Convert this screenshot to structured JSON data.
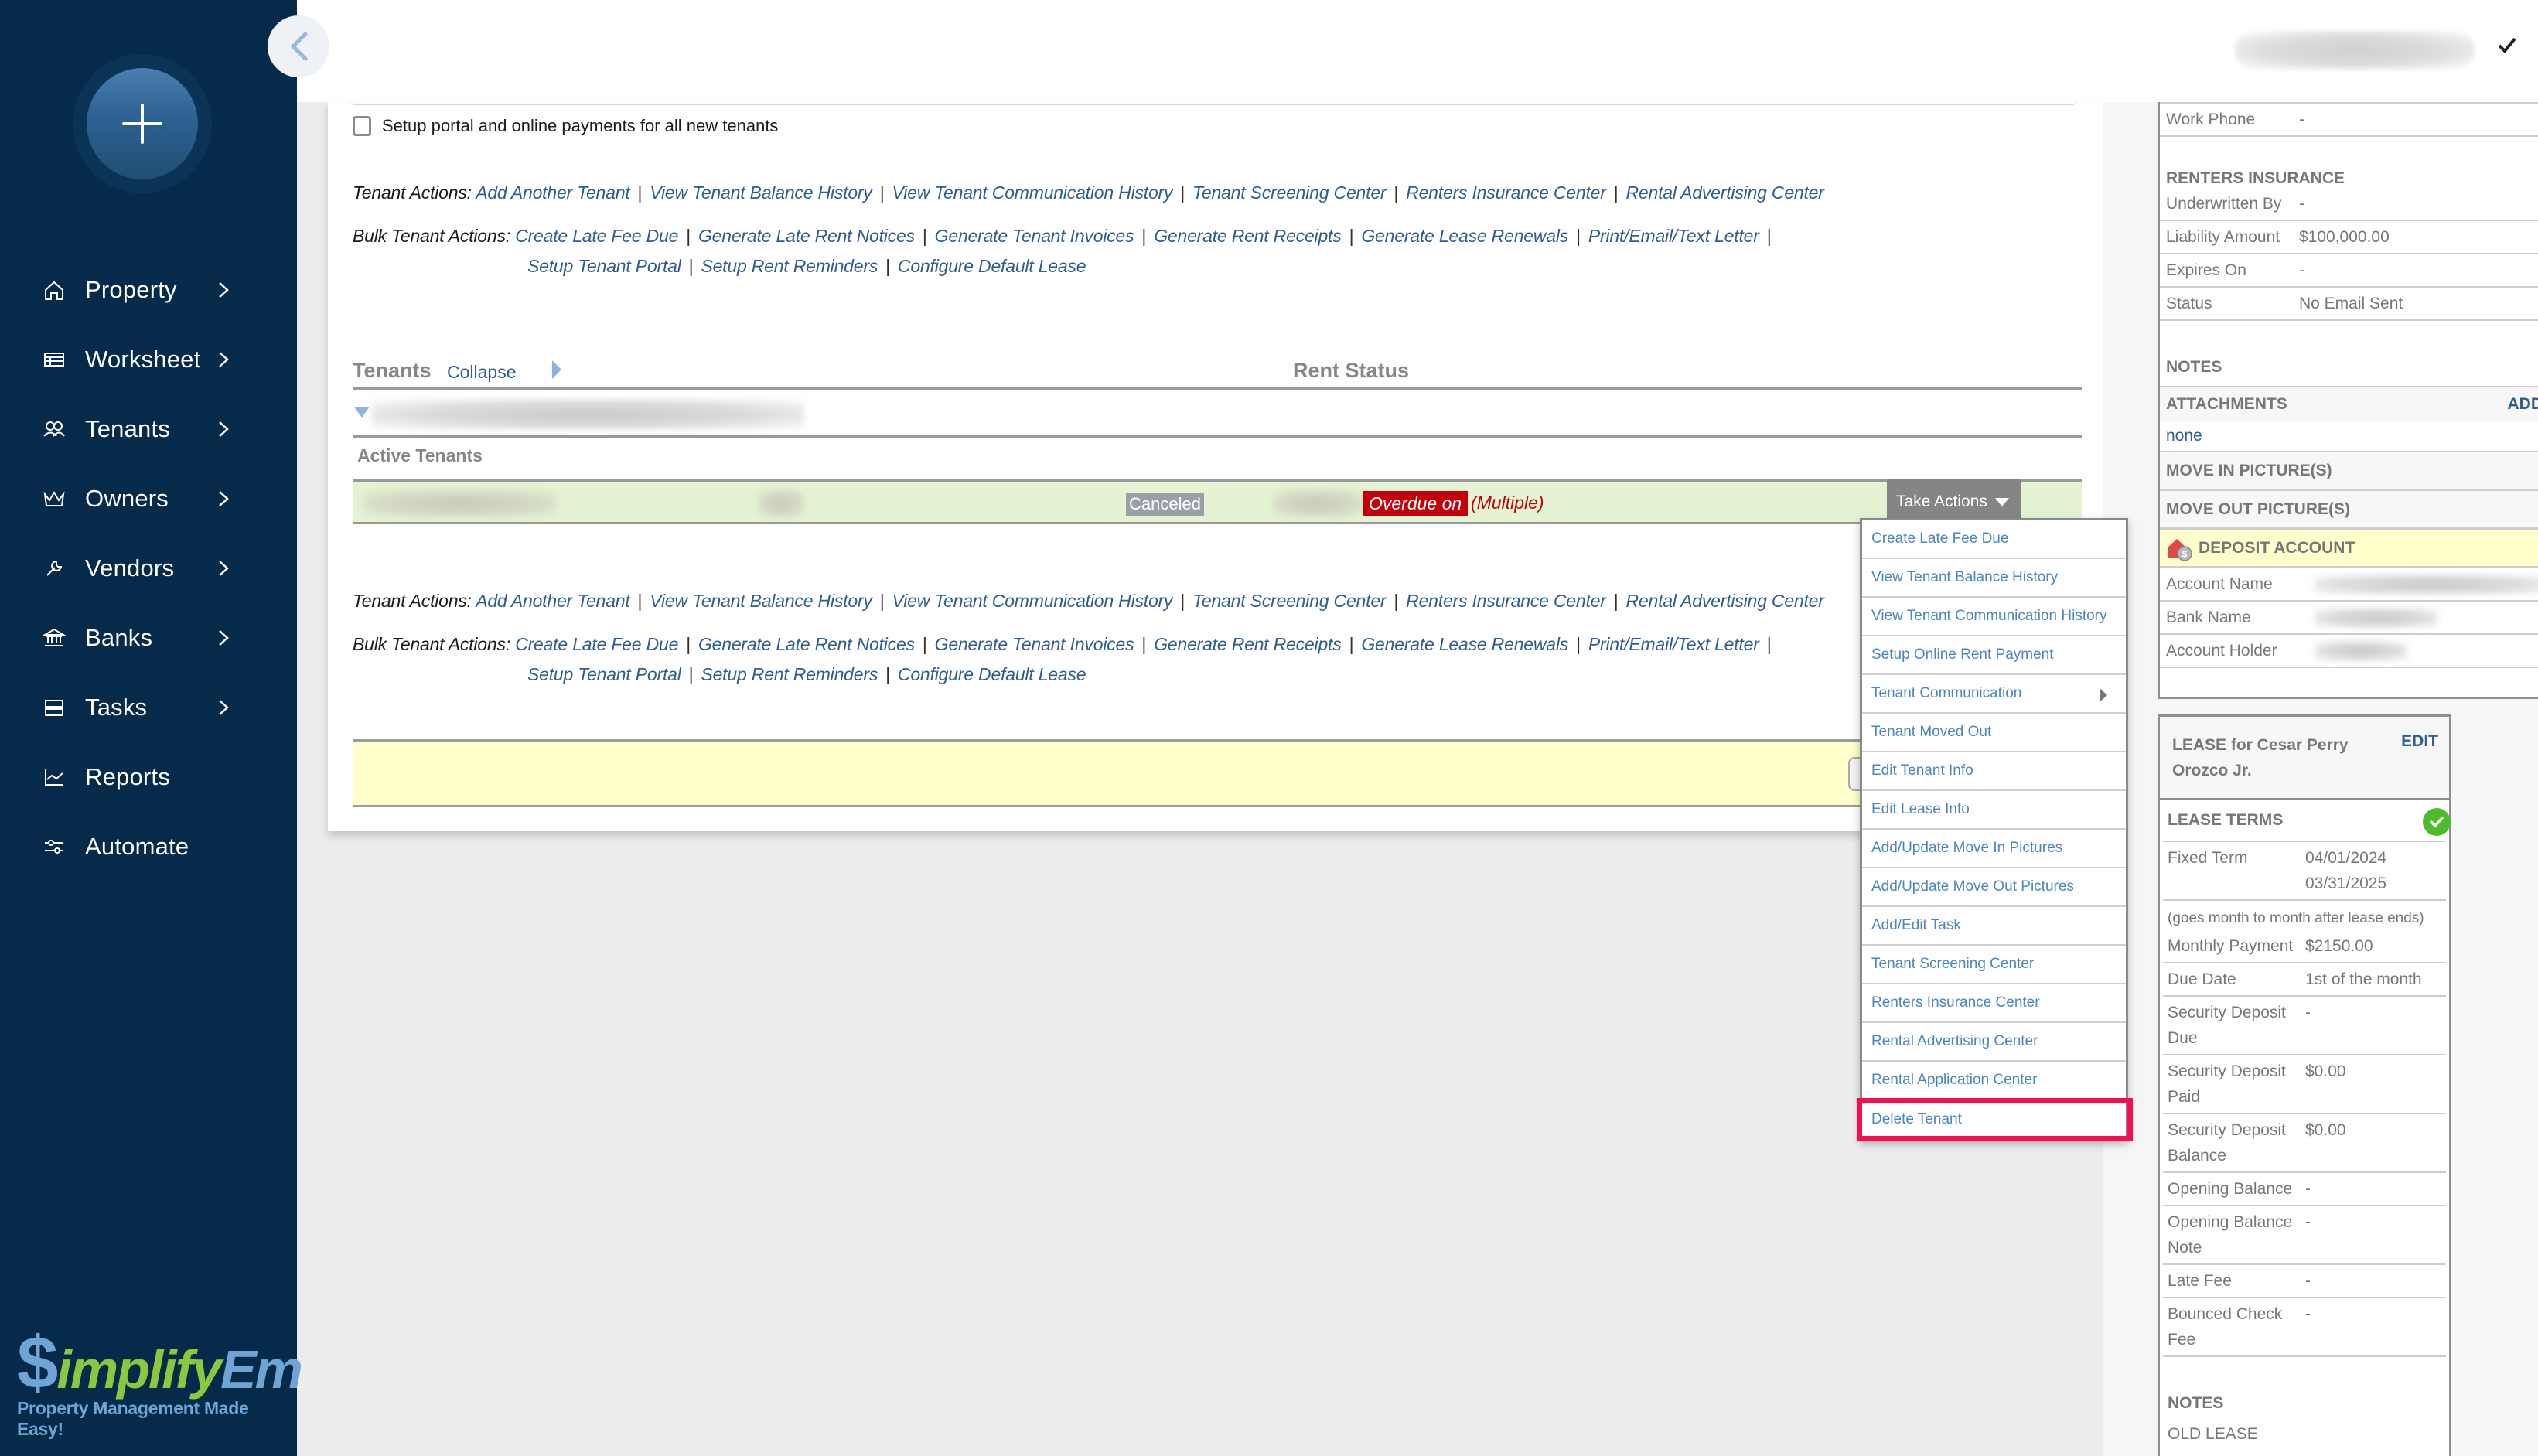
{
  "sidebar": {
    "add_button_icon": "plus-icon",
    "items": [
      {
        "label": "Property",
        "icon": "home-icon",
        "has_submenu": true
      },
      {
        "label": "Worksheet",
        "icon": "table-icon",
        "has_submenu": true
      },
      {
        "label": "Tenants",
        "icon": "users-icon",
        "has_submenu": true
      },
      {
        "label": "Owners",
        "icon": "crown-icon",
        "has_submenu": true
      },
      {
        "label": "Vendors",
        "icon": "wrench-icon",
        "has_submenu": true
      },
      {
        "label": "Banks",
        "icon": "bank-icon",
        "has_submenu": true
      },
      {
        "label": "Tasks",
        "icon": "tasks-icon",
        "has_submenu": true
      },
      {
        "label": "Reports",
        "icon": "chart-icon",
        "has_submenu": false
      },
      {
        "label": "Automate",
        "icon": "sliders-icon",
        "has_submenu": false
      }
    ],
    "logo": {
      "dollar": "$",
      "mid": "implify",
      "end": "Em",
      "tagline": "Property Management Made Easy!"
    }
  },
  "colors": {
    "sidebar_bg": "#052a4a",
    "link": "#2e5d8f",
    "menu_link": "#4a86c0",
    "overdue_red": "#c4000b",
    "tenant_row_bg": "#e4f4d2",
    "highlight": "#ff0a50",
    "logo_green": "#8dc63f",
    "logo_blue": "#6fa5d5"
  },
  "main": {
    "portal_checkbox_label": "Setup portal and online payments for all new tenants",
    "tenant_actions_label": "Tenant Actions:",
    "tenant_actions": [
      "Add Another Tenant",
      "View Tenant Balance History",
      "View Tenant Communication History",
      "Tenant Screening Center",
      "Renters Insurance Center",
      "Rental Advertising Center"
    ],
    "bulk_actions_label": "Bulk Tenant Actions:",
    "bulk_actions_row1": [
      "Create Late Fee Due",
      "Generate Late Rent Notices",
      "Generate Tenant Invoices",
      "Generate Rent Receipts",
      "Generate Lease Renewals",
      "Print/Email/Text Letter"
    ],
    "bulk_actions_row2": [
      "Setup Tenant Portal",
      "Setup Rent Reminders",
      "Configure Default Lease"
    ],
    "tenants_header": "Tenants",
    "collapse_label": "Collapse",
    "rent_status_header": "Rent Status",
    "active_tenants_label": "Active Tenants",
    "tenant_row": {
      "status_badge": "Canceled",
      "overdue_label": "Overdue on",
      "overdue_value": "(Multiple)",
      "take_actions_label": "Take Actions"
    }
  },
  "dropdown": {
    "items": [
      {
        "label": "Create Late Fee Due"
      },
      {
        "label": "View Tenant Balance History"
      },
      {
        "label": "View Tenant Communication History"
      },
      {
        "label": "Setup Online Rent Payment"
      },
      {
        "label": "Tenant Communication",
        "has_submenu": true
      },
      {
        "label": "Tenant Moved Out"
      },
      {
        "label": "Edit Tenant Info"
      },
      {
        "label": "Edit Lease Info"
      },
      {
        "label": "Add/Update Move In Pictures"
      },
      {
        "label": "Add/Update Move Out Pictures"
      },
      {
        "label": "Add/Edit Task"
      },
      {
        "label": "Tenant Screening Center"
      },
      {
        "label": "Renters Insurance Center"
      },
      {
        "label": "Rental Advertising Center"
      },
      {
        "label": "Rental Application Center"
      },
      {
        "label": "Delete Tenant",
        "highlighted": true
      }
    ]
  },
  "right_panel": {
    "work_phone": {
      "label": "Work Phone",
      "value": "-"
    },
    "renters_insurance": {
      "heading": "RENTERS INSURANCE",
      "rows": [
        {
          "label": "Underwritten By",
          "value": "-"
        },
        {
          "label": "Liability Amount",
          "value": "$100,000.00"
        },
        {
          "label": "Expires On",
          "value": "-"
        },
        {
          "label": "Status",
          "value": "No Email Sent"
        }
      ]
    },
    "notes_heading": "NOTES",
    "attachments": {
      "heading": "ATTACHMENTS",
      "add_label": "ADD",
      "value": "none"
    },
    "move_in_pictures": "MOVE IN PICTURE(S)",
    "move_out_pictures": "MOVE OUT PICTURE(S)",
    "deposit_account": {
      "heading": "DEPOSIT ACCOUNT",
      "rows": [
        {
          "label": "Account Name"
        },
        {
          "label": "Bank Name"
        },
        {
          "label": "Account Holder"
        }
      ]
    },
    "lease": {
      "title": "LEASE for Cesar Perry Orozco Jr.",
      "edit_label": "EDIT",
      "terms_heading": "LEASE TERMS",
      "fixed_term_label": "Fixed Term",
      "start_date": "04/01/2024",
      "end_date": "03/31/2025",
      "term_note": "(goes month to month after lease ends)",
      "rows": [
        {
          "label": "Monthly Payment",
          "value": "$2150.00"
        },
        {
          "label": "Due Date",
          "value": "1st of the month"
        },
        {
          "label": "Security Deposit Due",
          "value": "-"
        },
        {
          "label": "Security Deposit Paid",
          "value": "$0.00"
        },
        {
          "label": "Security Deposit Balance",
          "value": "$0.00"
        },
        {
          "label": "Opening Balance",
          "value": "-"
        },
        {
          "label": "Opening Balance Note",
          "value": "-"
        },
        {
          "label": "Late Fee",
          "value": "-"
        },
        {
          "label": "Bounced Check Fee",
          "value": "-"
        }
      ],
      "notes_heading": "NOTES",
      "notes_value": "OLD LEASE"
    }
  }
}
